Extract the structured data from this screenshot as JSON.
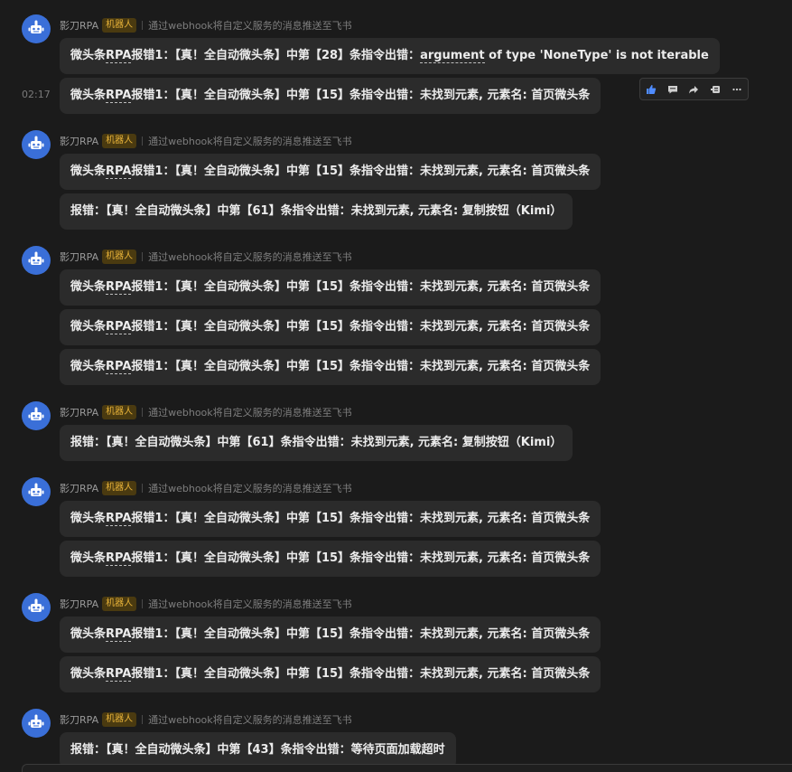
{
  "groups": [
    {
      "sender": "影刀RPA",
      "badge": "机器人",
      "source": "通过webhook将自定义服务的消息推送至飞书",
      "messages": [
        {
          "prefix": "微头条",
          "dotted": "RPA",
          "text": "报错1：【真！全自动微头条】中第【28】条指令出错：",
          "dotted2": "argument",
          "tail": " of type 'NoneType' is not iterable"
        },
        {
          "prefix": "微头条",
          "dotted": "RPA",
          "text": "报错1：【真！全自动微头条】中第【15】条指令出错：未找到元素, 元素名: 首页微头条"
        }
      ]
    },
    {
      "sender": "影刀RPA",
      "badge": "机器人",
      "source": "通过webhook将自定义服务的消息推送至飞书",
      "messages": [
        {
          "prefix": "微头条",
          "dotted": "RPA",
          "text": "报错1：【真！全自动微头条】中第【15】条指令出错：未找到元素, 元素名: 首页微头条"
        },
        {
          "prefix": "",
          "dotted": "",
          "text": "报错：【真！全自动微头条】中第【61】条指令出错：未找到元素, 元素名: 复制按钮（Kimi）"
        }
      ]
    },
    {
      "sender": "影刀RPA",
      "badge": "机器人",
      "source": "通过webhook将自定义服务的消息推送至飞书",
      "messages": [
        {
          "prefix": "微头条",
          "dotted": "RPA",
          "text": "报错1：【真！全自动微头条】中第【15】条指令出错：未找到元素, 元素名: 首页微头条"
        },
        {
          "prefix": "微头条",
          "dotted": "RPA",
          "text": "报错1：【真！全自动微头条】中第【15】条指令出错：未找到元素, 元素名: 首页微头条"
        },
        {
          "prefix": "微头条",
          "dotted": "RPA",
          "text": "报错1：【真！全自动微头条】中第【15】条指令出错：未找到元素, 元素名: 首页微头条"
        }
      ]
    },
    {
      "sender": "影刀RPA",
      "badge": "机器人",
      "source": "通过webhook将自定义服务的消息推送至飞书",
      "messages": [
        {
          "prefix": "",
          "dotted": "",
          "text": "报错：【真！全自动微头条】中第【61】条指令出错：未找到元素, 元素名: 复制按钮（Kimi）"
        }
      ]
    },
    {
      "sender": "影刀RPA",
      "badge": "机器人",
      "source": "通过webhook将自定义服务的消息推送至飞书",
      "messages": [
        {
          "prefix": "微头条",
          "dotted": "RPA",
          "text": "报错1：【真！全自动微头条】中第【15】条指令出错：未找到元素, 元素名: 首页微头条"
        },
        {
          "prefix": "微头条",
          "dotted": "RPA",
          "text": "报错1：【真！全自动微头条】中第【15】条指令出错：未找到元素, 元素名: 首页微头条"
        }
      ]
    },
    {
      "sender": "影刀RPA",
      "badge": "机器人",
      "source": "通过webhook将自定义服务的消息推送至飞书",
      "messages": [
        {
          "prefix": "微头条",
          "dotted": "RPA",
          "text": "报错1：【真！全自动微头条】中第【15】条指令出错：未找到元素, 元素名: 首页微头条"
        },
        {
          "prefix": "微头条",
          "dotted": "RPA",
          "text": "报错1：【真！全自动微头条】中第【15】条指令出错：未找到元素, 元素名: 首页微头条"
        }
      ]
    },
    {
      "sender": "影刀RPA",
      "badge": "机器人",
      "source": "通过webhook将自定义服务的消息推送至飞书",
      "messages": [
        {
          "prefix": "",
          "dotted": "",
          "text": "报错：【真！全自动微头条】中第【43】条指令出错：等待页面加载超时"
        }
      ]
    }
  ],
  "hover": {
    "time": "02:17",
    "icons": [
      "thumbs-up-icon",
      "comment-icon",
      "forward-icon",
      "quote-icon",
      "more-icon"
    ]
  },
  "colors": {
    "background": "#1b1b1b",
    "bubble": "#2b2b2b",
    "avatar": "#3a6fd8",
    "badge_text": "#e8b339",
    "like_icon": "#4f8cff"
  }
}
